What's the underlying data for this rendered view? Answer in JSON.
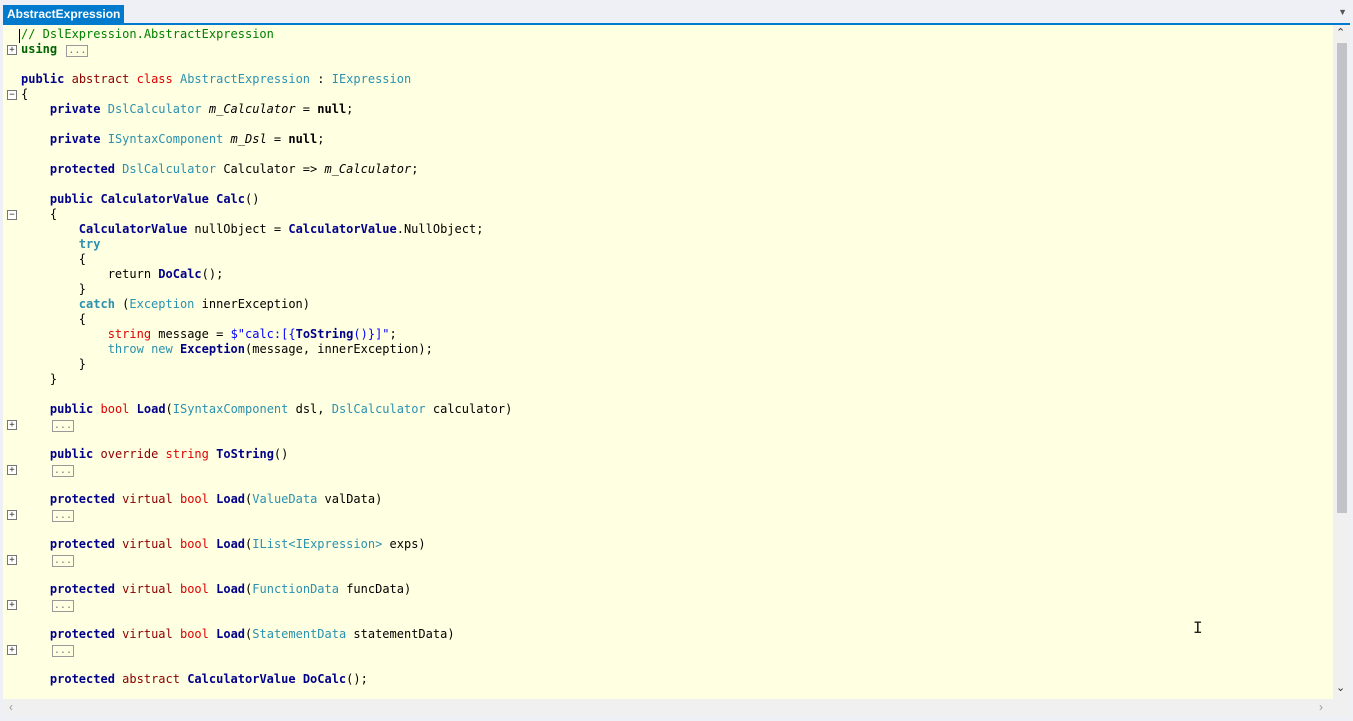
{
  "tab": {
    "title": "AbstractExpression"
  },
  "code": {
    "comment": "// DslExpression.AbstractExpression",
    "using_kw": "using",
    "fold_label": "...",
    "l3_public": "public",
    "l3_abstract": "abstract",
    "l3_class": "class",
    "l3_name": "AbstractExpression",
    "l3_colon": " : ",
    "l3_iface": "IExpression",
    "open_brace": "{",
    "close_brace": "}",
    "private": "private",
    "protected": "protected",
    "public": "public",
    "virtual": "virtual",
    "abstract": "abstract",
    "override": "override",
    "bool": "bool",
    "string": "string",
    "DslCalculator": "DslCalculator",
    "m_Calculator": "m_Calculator",
    "eq_null": " = ",
    "null": "null",
    "semi": ";",
    "ISyntaxComponent": "ISyntaxComponent",
    "m_Dsl": "m_Dsl",
    "Calculator": "Calculator",
    "arrow": " => ",
    "CalculatorValue": "CalculatorValue",
    "Calc": "Calc",
    "parens": "()",
    "nullObject": "nullObject",
    "NullObject": "NullObject",
    "try": "try",
    "return": "return",
    "DoCalc": "DoCalc",
    "catch": "catch",
    "Exception": "Exception",
    "innerException": "innerException",
    "message": "message",
    "str_prefix": "$\"calc:[{",
    "ToString": "ToString",
    "str_suffix": "()}]\"",
    "throw": "throw",
    "new": "new",
    "args_msg": "(message, innerException);",
    "Load": "Load",
    "dsl_args": " dsl, ",
    "calculator": " calculator)",
    "ValueData": "ValueData",
    "valData": " valData)",
    "IList": "IList<IExpression>",
    "exps": " exps)",
    "FunctionData": "FunctionData",
    "funcData": " funcData)",
    "StatementData": "StatementData",
    "statementData": " statementData)"
  },
  "gutter": {
    "plus": "+",
    "minus": "−"
  },
  "scroll": {
    "up": "⌃",
    "down": "⌄",
    "left": "‹",
    "right": "›"
  }
}
